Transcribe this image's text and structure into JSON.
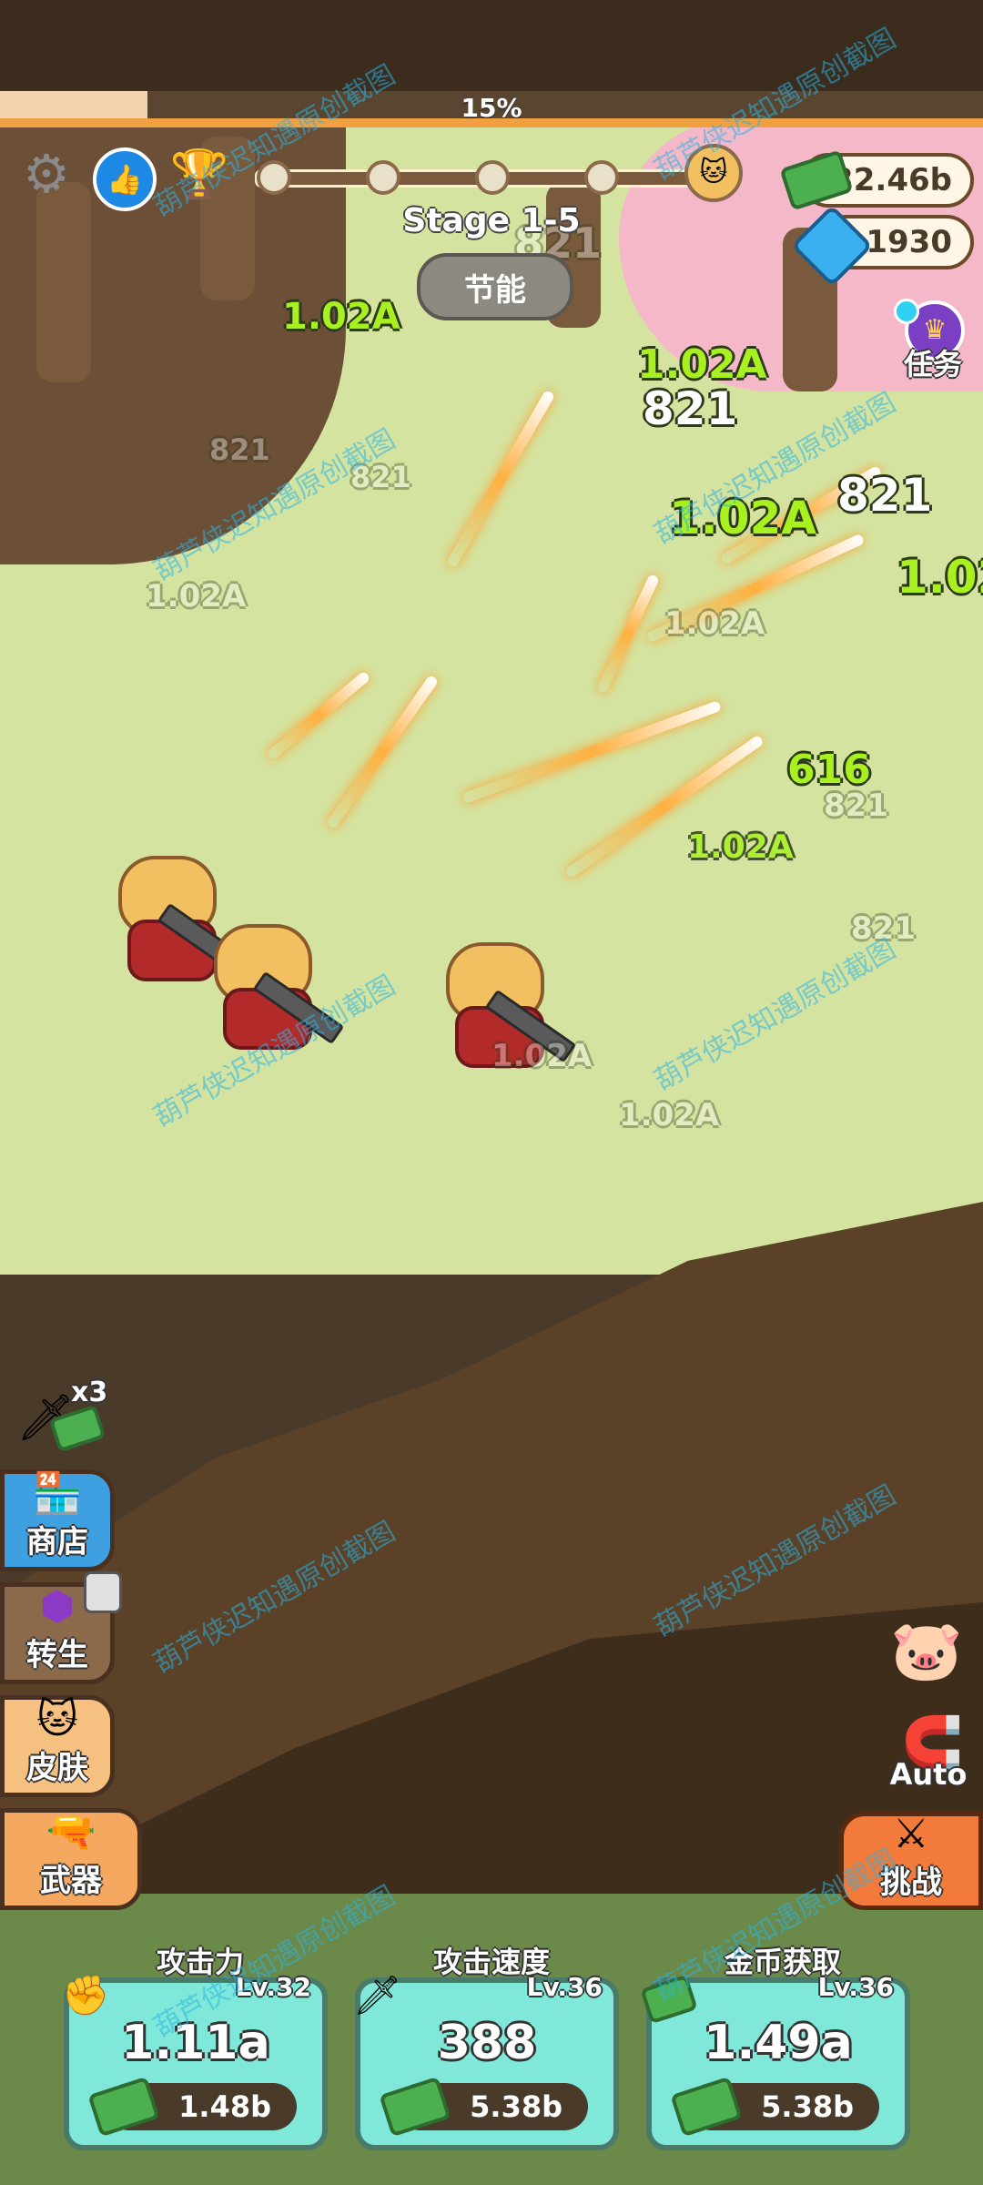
{
  "progress": {
    "percent_text": "15%",
    "fraction": 0.15
  },
  "top_bar": {
    "gear_icon": "gear-icon",
    "like_icon": "thumbs-up-icon",
    "trophy_icon": "trophy-icon",
    "stage_title": "Stage 1-5",
    "energy_button": "节能"
  },
  "currency": {
    "money": "32.46b",
    "gems": "1930"
  },
  "task": {
    "label": "任务"
  },
  "floating_texts": [
    {
      "text": "1.02A",
      "style": "green"
    },
    {
      "text": "1.02A",
      "style": "green"
    },
    {
      "text": "821",
      "style": "white"
    },
    {
      "text": "821",
      "style": "white"
    },
    {
      "text": "1.02A",
      "style": "green"
    },
    {
      "text": "1.02",
      "style": "green"
    },
    {
      "text": "1.02A",
      "style": "faint"
    },
    {
      "text": "1.02A",
      "style": "faint"
    },
    {
      "text": "821",
      "style": "faint"
    },
    {
      "text": "821",
      "style": "faint"
    },
    {
      "text": "821",
      "style": "faint"
    },
    {
      "text": "616",
      "style": "green"
    },
    {
      "text": "821",
      "style": "faint"
    },
    {
      "text": "1.02A",
      "style": "green"
    },
    {
      "text": "821",
      "style": "faint"
    },
    {
      "text": "1.02A",
      "style": "faint"
    },
    {
      "text": "1.02A",
      "style": "faint"
    },
    {
      "text": "821",
      "style": "white"
    }
  ],
  "buff": {
    "multiplier": "x3"
  },
  "side_menu": {
    "shop": "商店",
    "rebirth": "转生",
    "skin": "皮肤",
    "weapon": "武器"
  },
  "right_menu": {
    "auto": "Auto",
    "challenge": "挑战"
  },
  "upgrades": [
    {
      "title": "攻击力",
      "level": "Lv.32",
      "value": "1.11a",
      "cost": "1.48b"
    },
    {
      "title": "攻击速度",
      "level": "Lv.36",
      "value": "388",
      "cost": "5.38b"
    },
    {
      "title": "金币获取",
      "level": "Lv.36",
      "value": "1.49a",
      "cost": "5.38b"
    }
  ],
  "watermark": "葫芦侠迟知遇原创截图"
}
